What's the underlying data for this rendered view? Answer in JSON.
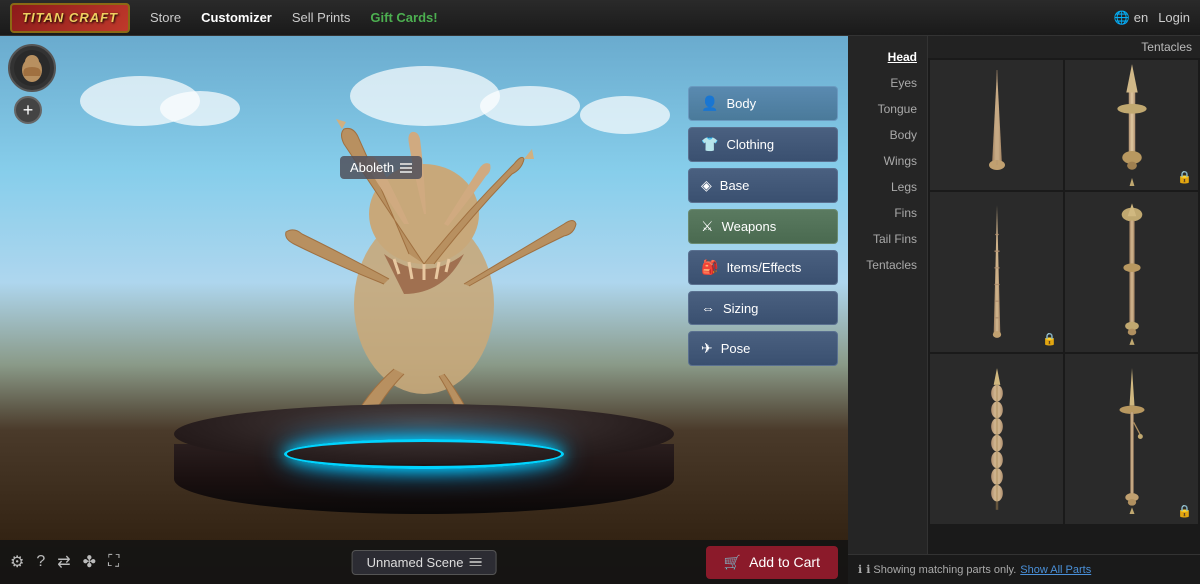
{
  "brand": {
    "name": "TITAN CRAFT"
  },
  "nav": {
    "links": [
      {
        "id": "store",
        "label": "Store",
        "active": false,
        "gift": false
      },
      {
        "id": "customizer",
        "label": "Customizer",
        "active": true,
        "gift": false
      },
      {
        "id": "sell-prints",
        "label": "Sell Prints",
        "active": false,
        "gift": false
      },
      {
        "id": "gift-cards",
        "label": "Gift Cards!",
        "active": false,
        "gift": true
      }
    ],
    "lang_label": "en",
    "login_label": "Login"
  },
  "viewport": {
    "creature_label": "Aboleth",
    "scene_label": "Unnamed Scene",
    "add_to_cart": "Add to Cart"
  },
  "customizer_buttons": [
    {
      "id": "body",
      "label": "Body",
      "icon": "👤",
      "active": true
    },
    {
      "id": "clothing",
      "label": "Clothing",
      "icon": "👕",
      "active": false
    },
    {
      "id": "base",
      "label": "Base",
      "icon": "⬟",
      "active": false
    },
    {
      "id": "weapons",
      "label": "Weapons",
      "icon": "⚔",
      "active": true
    },
    {
      "id": "items-effects",
      "label": "Items/Effects",
      "icon": "🎒",
      "active": false
    },
    {
      "id": "sizing",
      "label": "Sizing",
      "icon": "⇔",
      "active": false
    },
    {
      "id": "pose",
      "label": "Pose",
      "icon": "✈",
      "active": false
    }
  ],
  "parts_nav": {
    "items": [
      {
        "id": "head",
        "label": "Head",
        "active": true
      },
      {
        "id": "eyes",
        "label": "Eyes",
        "active": false
      },
      {
        "id": "tongue",
        "label": "Tongue",
        "active": false
      },
      {
        "id": "body",
        "label": "Body",
        "active": false
      },
      {
        "id": "wings",
        "label": "Wings",
        "active": false
      },
      {
        "id": "legs",
        "label": "Legs",
        "active": false
      },
      {
        "id": "fins",
        "label": "Fins",
        "active": false
      },
      {
        "id": "tail-fins",
        "label": "Tail Fins",
        "active": false
      },
      {
        "id": "tentacles",
        "label": "Tentacles",
        "active": false
      }
    ]
  },
  "parts_grid": {
    "top_right_label": "Tentacles",
    "parts": [
      {
        "id": "part1",
        "locked": false,
        "label": ""
      },
      {
        "id": "part2",
        "locked": true,
        "label": ""
      },
      {
        "id": "part3",
        "locked": false,
        "label": ""
      },
      {
        "id": "part4",
        "locked": true,
        "label": ""
      },
      {
        "id": "part5",
        "locked": false,
        "label": ""
      },
      {
        "id": "part6",
        "locked": true,
        "label": ""
      }
    ]
  },
  "bottom_bar": {
    "info_text": "ℹ Showing matching parts only.",
    "show_all_text": "Show All Parts"
  },
  "toolbar_icons": [
    "⚙",
    "?",
    "⇄",
    "☩",
    "⛶"
  ],
  "colors": {
    "accent_blue": "#4a7ab0",
    "active_button": "#5a8ab0",
    "cart_red": "#8b1a2a",
    "glow_blue": "#00d4ff",
    "gift_green": "#4caf50",
    "nav_active": "#ffffff"
  }
}
